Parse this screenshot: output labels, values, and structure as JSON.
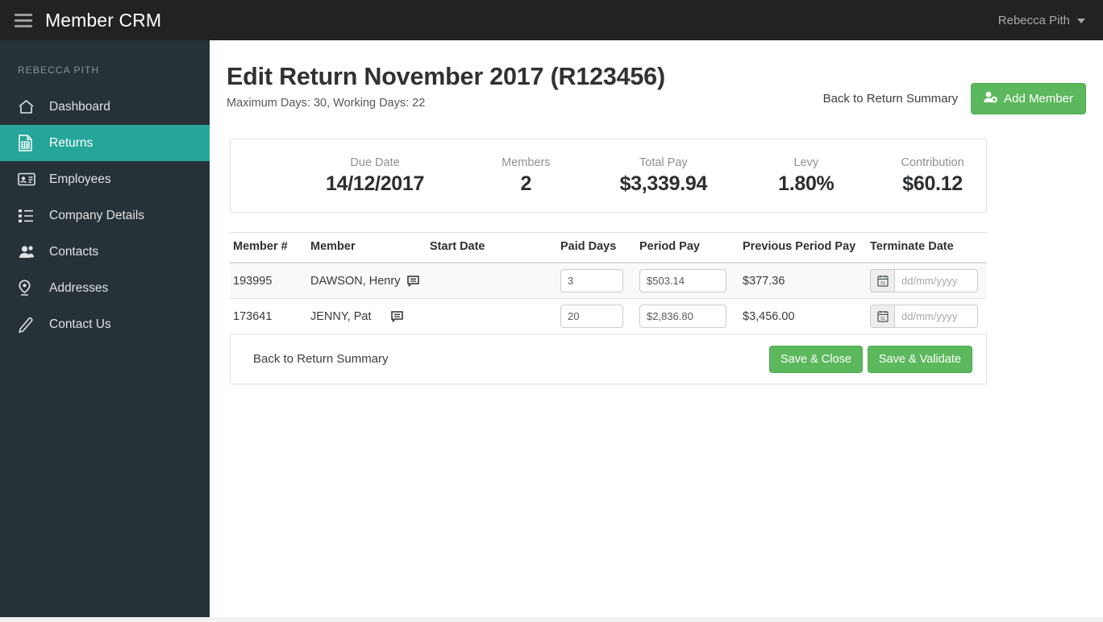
{
  "topbar": {
    "menu_icon": "hamburger-icon",
    "brand": "Member CRM",
    "user": "Rebecca Pith",
    "caret_icon": "chevron-down-icon"
  },
  "sidebar": {
    "heading": "REBECCA PITH",
    "items": [
      {
        "label": "Dashboard",
        "icon": "home-icon",
        "active": false
      },
      {
        "label": "Returns",
        "icon": "report-icon",
        "active": true
      },
      {
        "label": "Employees",
        "icon": "id-card-icon",
        "active": false
      },
      {
        "label": "Company Details",
        "icon": "list-icon",
        "active": false
      },
      {
        "label": "Contacts",
        "icon": "contacts-icon",
        "active": false
      },
      {
        "label": "Addresses",
        "icon": "map-pin-icon",
        "active": false
      },
      {
        "label": "Contact Us",
        "icon": "pencil-icon",
        "active": false
      }
    ],
    "active_color": "#26a69a",
    "bg_color": "#263238"
  },
  "page": {
    "title": "Edit Return November 2017 (R123456)",
    "subtitle": "Maximum Days: 30, Working Days: 22",
    "back_link": "Back to Return Summary",
    "add_member_label": "Add Member",
    "add_member_icon": "user-plus-icon",
    "accent_green": "#5cb85c"
  },
  "stats": [
    {
      "label": "Due Date",
      "value": "14/12/2017"
    },
    {
      "label": "Members",
      "value": "2"
    },
    {
      "label": "Total Pay",
      "value": "$3,339.94"
    },
    {
      "label": "Levy",
      "value": "1.80%"
    },
    {
      "label": "Contribution",
      "value": "$60.12"
    }
  ],
  "table": {
    "columns": [
      "Member #",
      "Member",
      "Start Date",
      "Paid Days",
      "Period Pay",
      "Previous Period Pay",
      "Terminate Date"
    ],
    "date_placeholder": "dd/mm/yyyy",
    "calendar_icon": "calendar-icon",
    "comment_icon": "comment-icon",
    "rows": [
      {
        "member_number": "193995",
        "member_name": "DAWSON, Henry",
        "start_date": "",
        "paid_days": "3",
        "period_pay": "$503.14",
        "previous_period_pay": "$377.36",
        "terminate_date": ""
      },
      {
        "member_number": "173641",
        "member_name": "JENNY, Pat",
        "start_date": "",
        "paid_days": "20",
        "period_pay": "$2,836.80",
        "previous_period_pay": "$3,456.00",
        "terminate_date": ""
      }
    ]
  },
  "footer": {
    "back_link": "Back to Return Summary",
    "save_close": "Save & Close",
    "save_validate": "Save & Validate"
  }
}
